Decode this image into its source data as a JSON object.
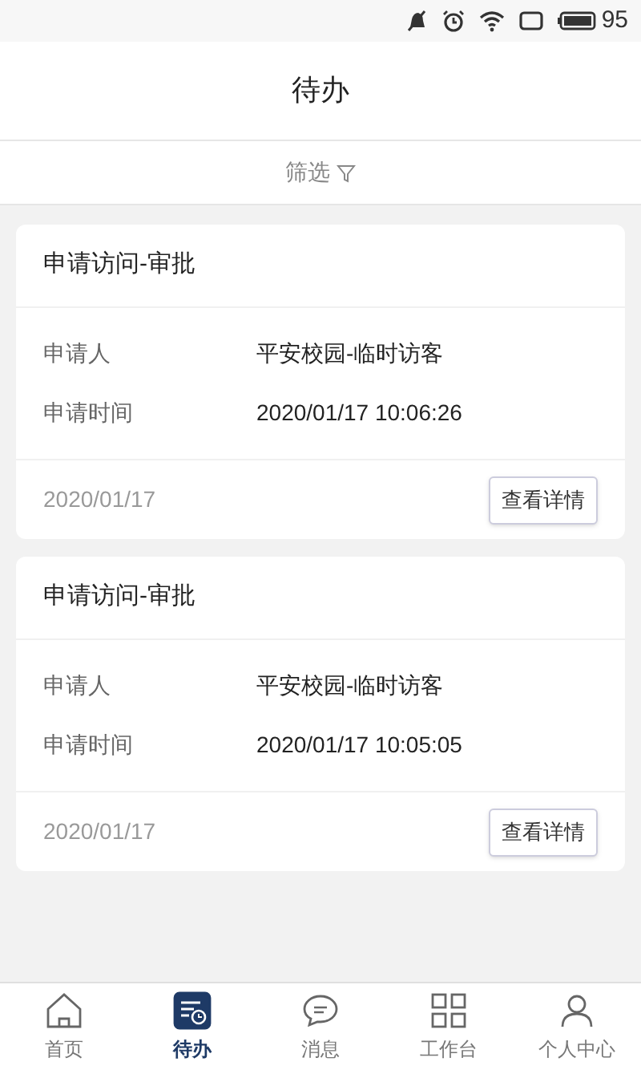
{
  "status_bar": {
    "battery": "95"
  },
  "header": {
    "title": "待办"
  },
  "filter": {
    "label": "筛选"
  },
  "cards": [
    {
      "title": "申请访问-审批",
      "fields": [
        {
          "label": "申请人",
          "value": "平安校园-临时访客"
        },
        {
          "label": "申请时间",
          "value": "2020/01/17 10:06:26"
        }
      ],
      "date": "2020/01/17",
      "button": "查看详情"
    },
    {
      "title": "申请访问-审批",
      "fields": [
        {
          "label": "申请人",
          "value": "平安校园-临时访客"
        },
        {
          "label": "申请时间",
          "value": "2020/01/17 10:05:05"
        }
      ],
      "date": "2020/01/17",
      "button": "查看详情"
    }
  ],
  "tab_bar": [
    {
      "kind": "home",
      "label": "首页",
      "selected": false
    },
    {
      "kind": "todo",
      "label": "待办",
      "selected": true
    },
    {
      "kind": "message",
      "label": "消息",
      "selected": false
    },
    {
      "kind": "workbench",
      "label": "工作台",
      "selected": false
    },
    {
      "kind": "profile",
      "label": "个人中心",
      "selected": false
    }
  ]
}
